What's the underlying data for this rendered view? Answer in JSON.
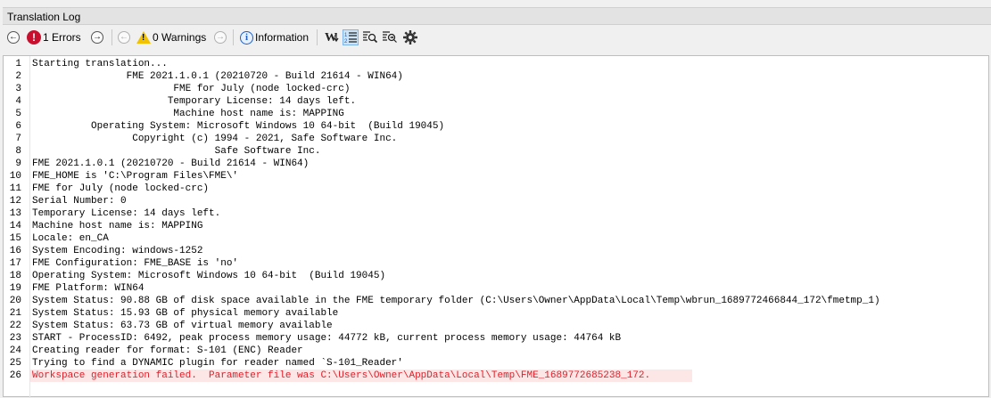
{
  "panel": {
    "title": "Translation Log"
  },
  "toolbar": {
    "errors_label": "1 Errors",
    "warnings_label": "0 Warnings",
    "information_label": "Information"
  },
  "log_lines": [
    {
      "n": "1",
      "text": "Starting translation...",
      "error": false
    },
    {
      "n": "2",
      "text": "                FME 2021.1.0.1 (20210720 - Build 21614 - WIN64)",
      "error": false
    },
    {
      "n": "3",
      "text": "                        FME for July (node locked-crc)",
      "error": false
    },
    {
      "n": "4",
      "text": "                       Temporary License: 14 days left.",
      "error": false
    },
    {
      "n": "5",
      "text": "                        Machine host name is: MAPPING",
      "error": false
    },
    {
      "n": "6",
      "text": "          Operating System: Microsoft Windows 10 64-bit  (Build 19045)",
      "error": false
    },
    {
      "n": "7",
      "text": "                 Copyright (c) 1994 - 2021, Safe Software Inc.",
      "error": false
    },
    {
      "n": "8",
      "text": "                               Safe Software Inc.",
      "error": false
    },
    {
      "n": "9",
      "text": "FME 2021.1.0.1 (20210720 - Build 21614 - WIN64)",
      "error": false
    },
    {
      "n": "10",
      "text": "FME_HOME is 'C:\\Program Files\\FME\\'",
      "error": false
    },
    {
      "n": "11",
      "text": "FME for July (node locked-crc)",
      "error": false
    },
    {
      "n": "12",
      "text": "Serial Number: 0",
      "error": false
    },
    {
      "n": "13",
      "text": "Temporary License: 14 days left.",
      "error": false
    },
    {
      "n": "14",
      "text": "Machine host name is: MAPPING",
      "error": false
    },
    {
      "n": "15",
      "text": "Locale: en_CA",
      "error": false
    },
    {
      "n": "16",
      "text": "System Encoding: windows-1252",
      "error": false
    },
    {
      "n": "17",
      "text": "FME Configuration: FME_BASE is 'no'",
      "error": false
    },
    {
      "n": "18",
      "text": "Operating System: Microsoft Windows 10 64-bit  (Build 19045)",
      "error": false
    },
    {
      "n": "19",
      "text": "FME Platform: WIN64",
      "error": false
    },
    {
      "n": "20",
      "text": "System Status: 90.88 GB of disk space available in the FME temporary folder (C:\\Users\\Owner\\AppData\\Local\\Temp\\wbrun_1689772466844_172\\fmetmp_1)",
      "error": false
    },
    {
      "n": "21",
      "text": "System Status: 15.93 GB of physical memory available",
      "error": false
    },
    {
      "n": "22",
      "text": "System Status: 63.73 GB of virtual memory available",
      "error": false
    },
    {
      "n": "23",
      "text": "START - ProcessID: 6492, peak process memory usage: 44772 kB, current process memory usage: 44764 kB",
      "error": false
    },
    {
      "n": "24",
      "text": "Creating reader for format: S-101 (ENC) Reader",
      "error": false
    },
    {
      "n": "25",
      "text": "Trying to find a DYNAMIC plugin for reader named `S-101_Reader'",
      "error": false
    },
    {
      "n": "26",
      "text": "Workspace generation failed.  Parameter file was C:\\Users\\Owner\\AppData\\Local\\Temp\\FME_1689772685238_172.",
      "error": true
    }
  ]
}
